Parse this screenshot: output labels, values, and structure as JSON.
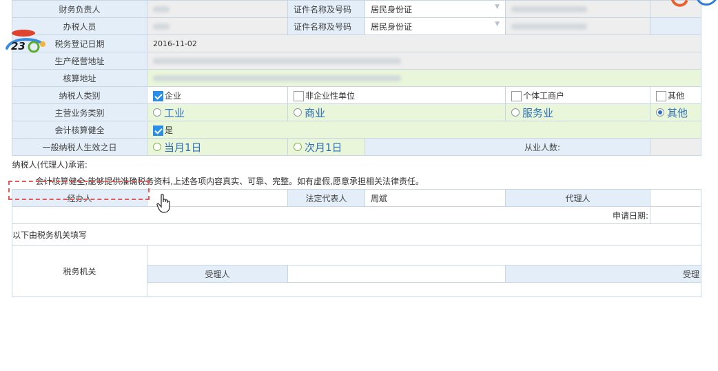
{
  "rows": {
    "financial_officer": {
      "label": "财务负责人",
      "id_label": "证件名称及号码",
      "id_type": "居民身份证"
    },
    "tax_handler": {
      "label": "办税人员",
      "id_label": "证件名称及号码",
      "id_type": "居民身份证"
    },
    "registration_date": {
      "label": "税务登记日期",
      "value": "2016-11-02"
    },
    "business_address": {
      "label": "生产经营地址"
    },
    "accounting_address": {
      "label": "核算地址"
    },
    "taxpayer_type": {
      "label": "纳税人类别",
      "options": [
        "企业",
        "非企业性单位",
        "个体工商户",
        "其他"
      ],
      "selected": "企业"
    },
    "main_business": {
      "label": "主营业务类别",
      "options": [
        "工业",
        "商业",
        "服务业",
        "其他"
      ],
      "selected": "其他"
    },
    "accounting_sound": {
      "label": "会计核算健全",
      "option": "是"
    },
    "effective_date": {
      "label": "一般纳税人生效之日",
      "options": [
        "当月1日",
        "次月1日"
      ],
      "employees_label": "从业人数:"
    }
  },
  "declaration": {
    "heading": "纳税人(代理人)承诺:",
    "text": "会计核算健全,能够提供准确税务资料,上述各项内容真实、可靠、完整。如有虚假,愿意承担相关法律责任。"
  },
  "signers": {
    "handler": "经办人",
    "legal_rep_label": "法定代表人",
    "legal_rep_value": "周斌",
    "agent": "代理人"
  },
  "apply_date_label": "申请日期:",
  "tax_section": {
    "heading": "以下由税务机关填写",
    "authority": "税务机关",
    "receiver": "受理人",
    "receiver2": "受理"
  }
}
